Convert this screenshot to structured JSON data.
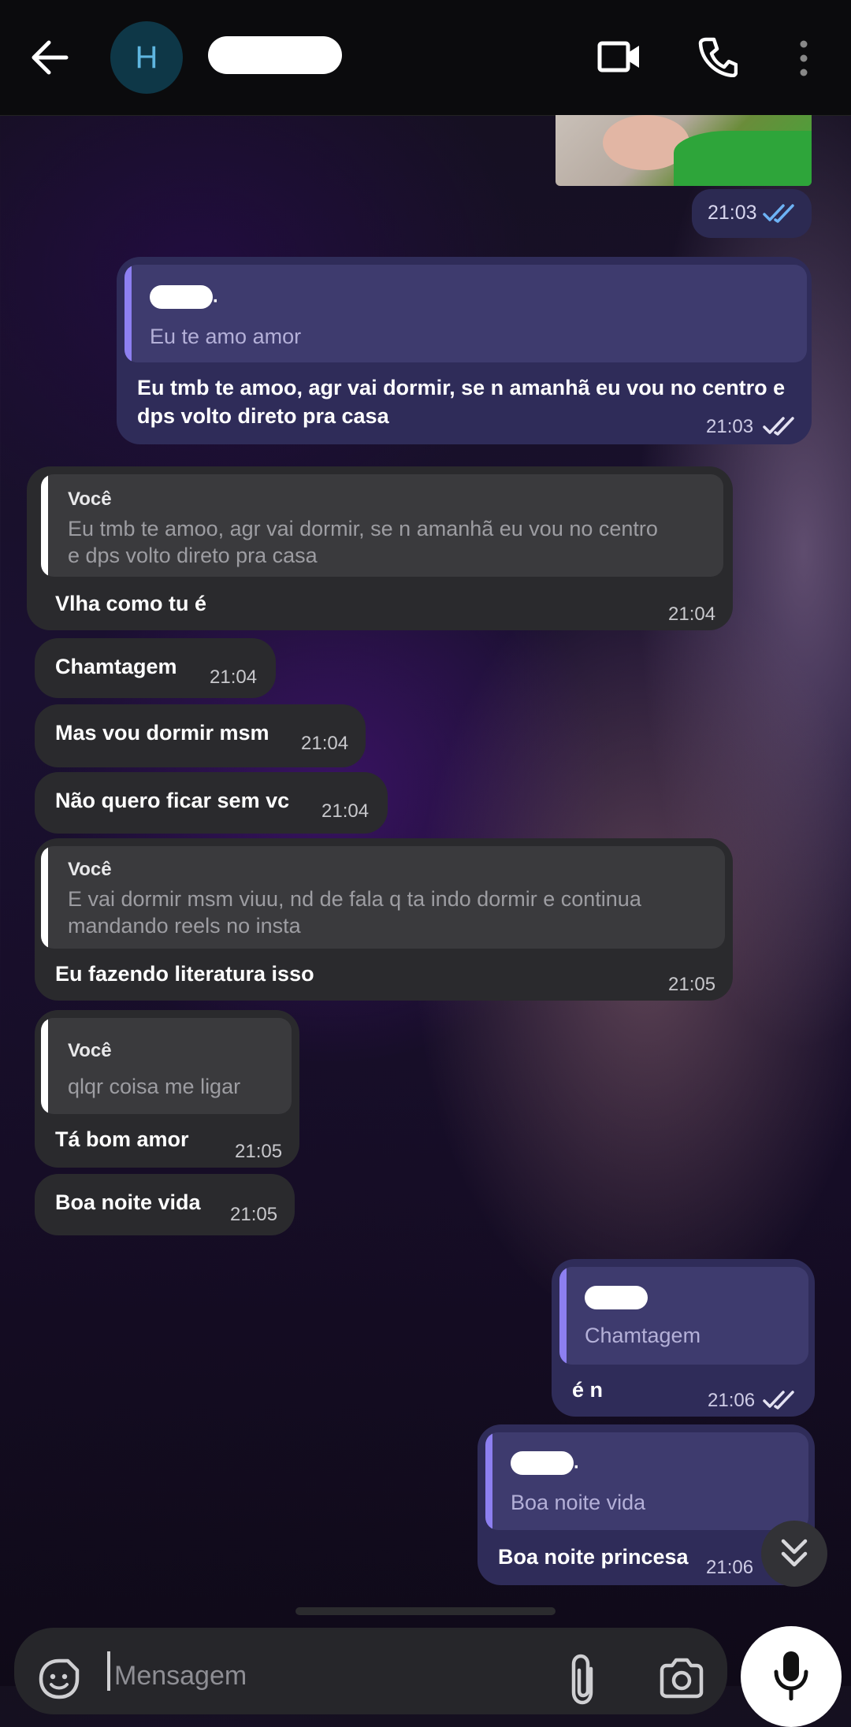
{
  "header": {
    "avatar_initial": "H",
    "contact_name": "redacted"
  },
  "messages": [
    {
      "id": "m0",
      "direction": "out",
      "time": "21:03",
      "status": "read"
    },
    {
      "id": "m1",
      "direction": "out",
      "reply_to": {
        "name": "redacted",
        "name_suffix": ".",
        "text": "Eu te amo amor"
      },
      "text_line1": "Eu tmb te amoo, agr vai dormir, se n amanhã eu vou no centro e",
      "text_line2": "dps volto direto pra casa",
      "time": "21:03",
      "status": "delivered"
    },
    {
      "id": "m2",
      "direction": "in",
      "reply_to": {
        "name": "Você",
        "text_line1": "Eu tmb te amoo, agr vai dormir, se n amanhã eu vou no centro",
        "text_line2": "e dps volto direto pra casa"
      },
      "text": "Vlha como tu é",
      "time": "21:04"
    },
    {
      "id": "m3",
      "direction": "in",
      "text": "Chamtagem",
      "time": "21:04"
    },
    {
      "id": "m4",
      "direction": "in",
      "text": "Mas vou dormir msm",
      "time": "21:04"
    },
    {
      "id": "m5",
      "direction": "in",
      "text": "Não quero ficar sem vc",
      "time": "21:04"
    },
    {
      "id": "m6",
      "direction": "in",
      "reply_to": {
        "name": "Você",
        "text_line1": "E vai dormir msm viuu, nd de fala q ta indo dormir e continua",
        "text_line2": "mandando reels no insta"
      },
      "text": "Eu fazendo literatura isso",
      "time": "21:05"
    },
    {
      "id": "m7",
      "direction": "in",
      "reply_to": {
        "name": "Você",
        "text": "qlqr coisa me ligar"
      },
      "text": "Tá bom amor",
      "time": "21:05"
    },
    {
      "id": "m8",
      "direction": "in",
      "text": "Boa noite vida",
      "time": "21:05"
    },
    {
      "id": "m9",
      "direction": "out",
      "reply_to": {
        "name": "redacted",
        "text": "Chamtagem"
      },
      "text": "é n",
      "time": "21:06",
      "status": "delivered"
    },
    {
      "id": "m10",
      "direction": "out",
      "reply_to": {
        "name": "redacted",
        "name_suffix": ".",
        "text": "Boa noite vida"
      },
      "text": "Boa noite princesa",
      "time": "21:06"
    }
  ],
  "composer": {
    "placeholder": "Mensagem"
  },
  "icons": {
    "back": "arrow-left-icon",
    "video": "video-call-icon",
    "call": "phone-icon",
    "more": "more-vertical-icon",
    "sticker": "sticker-icon",
    "attach": "paperclip-icon",
    "camera": "camera-icon",
    "mic": "mic-icon",
    "scroll": "double-chevron-down-icon"
  },
  "colors": {
    "outgoing_bubble": "#2f2c59",
    "incoming_bubble": "#2a2a2d",
    "read_ticks": "#6db2f5",
    "reply_bar_out": "#8d7ff0"
  }
}
